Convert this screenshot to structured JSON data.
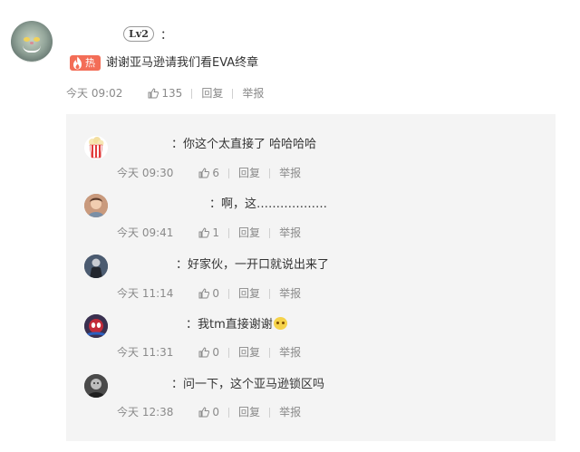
{
  "main_comment": {
    "level": "Lv2",
    "colon": "：",
    "hot_label": "热",
    "text": "谢谢亚马逊请我们看EVA终章",
    "time": "今天 09:02",
    "likes": "135",
    "reply_label": "回复",
    "report_label": "举报"
  },
  "replies": [
    {
      "prefix": "：",
      "text": "你这个太直接了 哈哈哈哈",
      "time": "今天 09:30",
      "likes": "6",
      "reply_label": "回复",
      "report_label": "举报"
    },
    {
      "prefix": "：",
      "text": "啊，这………………",
      "time": "今天 09:41",
      "likes": "1",
      "reply_label": "回复",
      "report_label": "举报"
    },
    {
      "prefix": "：",
      "text": "好家伙，一开口就说出来了",
      "time": "今天 11:14",
      "likes": "0",
      "reply_label": "回复",
      "report_label": "举报"
    },
    {
      "prefix": "：",
      "text": "我tm直接谢谢",
      "time": "今天 11:31",
      "likes": "0",
      "reply_label": "回复",
      "report_label": "举报"
    },
    {
      "prefix": "：",
      "text": "问一下，这个亚马逊锁区吗",
      "time": "今天 12:38",
      "likes": "0",
      "reply_label": "回复",
      "report_label": "举报"
    }
  ],
  "icons": {
    "like": "thumbs-up-icon",
    "hot": "flame-icon",
    "emoji": "dog-face-emoji"
  },
  "colors": {
    "hot_badge": "#f36d57",
    "meta_text": "#8a8a8a",
    "reply_bg": "#f4f4f4"
  }
}
